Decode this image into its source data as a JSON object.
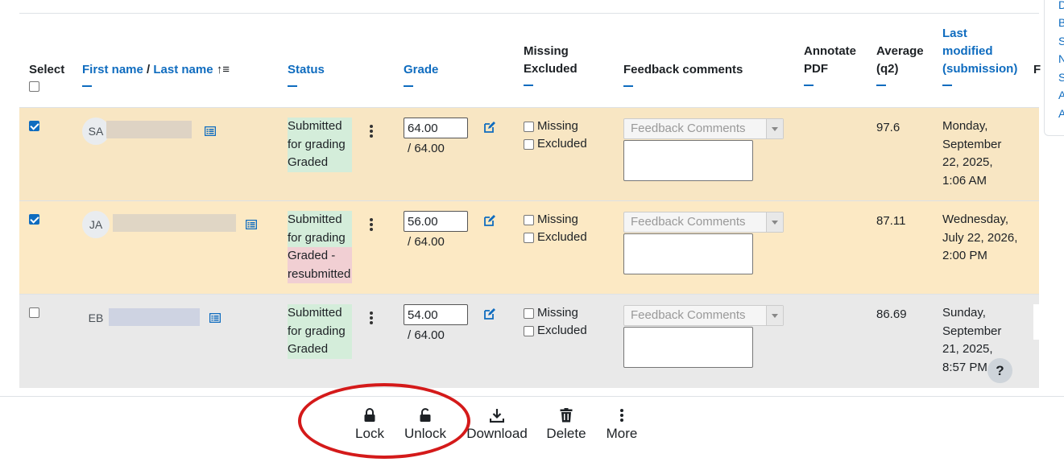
{
  "headers": {
    "select": "Select",
    "first_name": "First name",
    "slash": "/",
    "last_name": "Last name",
    "sort_icon": "↑≡",
    "status": "Status",
    "grade": "Grade",
    "missing": "Missing",
    "excluded": "Excluded",
    "feedback": "Feedback comments",
    "annotate1": "Annotate",
    "annotate2": "PDF",
    "average1": "Average",
    "average2": "(q2)",
    "lastmod1": "Last",
    "lastmod2": "modified",
    "lastmod3": "(submission)",
    "cut": "F"
  },
  "rows": [
    {
      "selected": true,
      "initials": "SA",
      "status1": "Submitted",
      "status2": "for grading",
      "status3": "Graded",
      "grade": "64.00",
      "grade_of": "/ 64.00",
      "missing_label": "Missing",
      "excluded_label": "Excluded",
      "feedback_placeholder": "Feedback Comments",
      "average": "97.6",
      "mod1": "Monday,",
      "mod2": "September",
      "mod3": "22, 2025,",
      "mod4": "1:06 AM"
    },
    {
      "selected": true,
      "initials": "JA",
      "status1": "Submitted",
      "status2": "for grading",
      "status3": "Graded -",
      "status4": "resubmitted",
      "grade": "56.00",
      "grade_of": "/ 64.00",
      "missing_label": "Missing",
      "excluded_label": "Excluded",
      "feedback_placeholder": "Feedback Comments",
      "average": "87.11",
      "mod1": "Wednesday,",
      "mod2": "July 22, 2026,",
      "mod3": "2:00 PM"
    },
    {
      "selected": false,
      "initials": "EB",
      "status1": "Submitted",
      "status2": "for grading",
      "status3": "Graded",
      "grade": "54.00",
      "grade_of": "/ 64.00",
      "missing_label": "Missing",
      "excluded_label": "Excluded",
      "feedback_placeholder": "Feedback Comments",
      "average": "86.69",
      "mod1": "Sunday,",
      "mod2": "September",
      "mod3": "21, 2025,",
      "mod4": "8:57 PM"
    }
  ],
  "help_label": "?",
  "footer": {
    "lock": "Lock",
    "unlock": "Unlock",
    "download": "Download",
    "delete": "Delete",
    "more": "More"
  },
  "right_panel_letters": [
    "D",
    "B",
    "S",
    "N",
    "S",
    "A",
    "A"
  ],
  "colors": {
    "link": "#0f6cbf",
    "selected_row": "#fce9c4",
    "status_green": "#d4edda",
    "status_pink": "#f1cfd3",
    "annotation_circle": "#d41a1a"
  }
}
